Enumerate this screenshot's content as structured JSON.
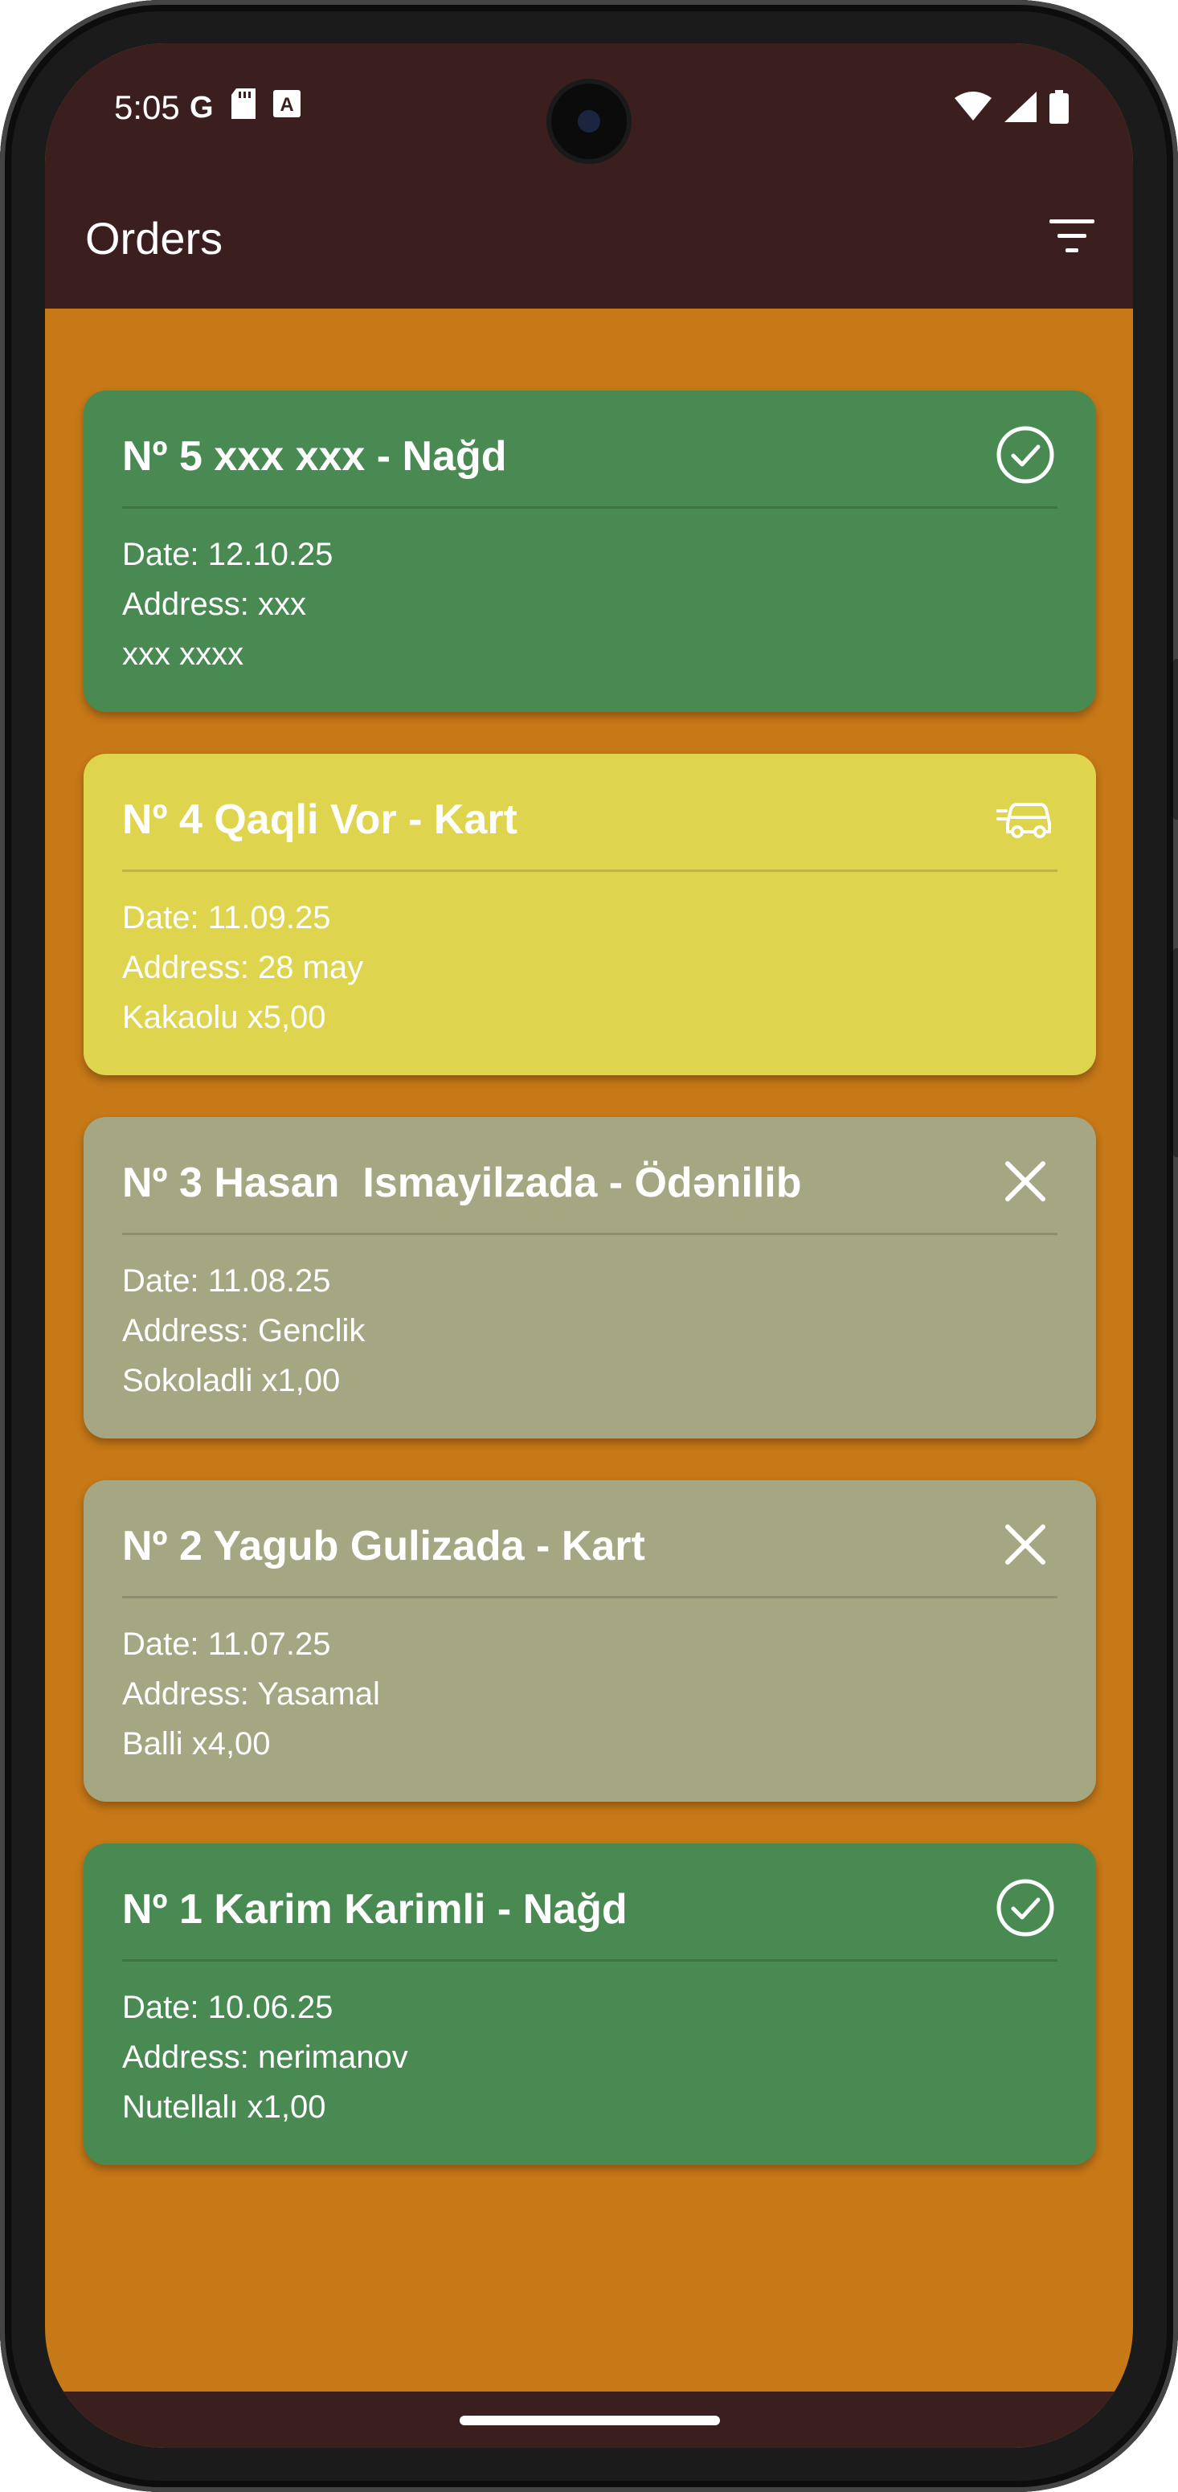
{
  "status_bar": {
    "time": "5:05",
    "left_icons": [
      "google-icon",
      "sd-card-icon",
      "font-icon"
    ],
    "right_icons": [
      "wifi-icon",
      "signal-icon",
      "battery-icon"
    ]
  },
  "app_bar": {
    "title": "Orders",
    "action_icon": "filter-icon"
  },
  "colors": {
    "app_bar": "#3B1F1F",
    "background": "#C77817",
    "completed": "#498A52",
    "in_delivery": "#DED44E",
    "cancelled": "#A5A783"
  },
  "orders": [
    {
      "title": "Nº 5 xxx xxx - Nağd",
      "date": "Date: 12.10.25",
      "address": "Address: xxx",
      "items": "xxx xxxx",
      "status": "completed",
      "status_icon": "check-circle-icon"
    },
    {
      "title": "Nº 4 Qaqli Vor - Kart",
      "date": "Date: 11.09.25",
      "address": "Address: 28 may",
      "items": "Kakaolu x5,00",
      "status": "in_delivery",
      "status_icon": "delivery-car-icon"
    },
    {
      "title": "Nº 3 Hasan  Ismayilzada - Ödənilib",
      "date": "Date: 11.08.25",
      "address": "Address: Genclik",
      "items": "Sokoladli x1,00",
      "status": "cancelled",
      "status_icon": "close-icon"
    },
    {
      "title": "Nº 2 Yagub Gulizada - Kart",
      "date": "Date: 11.07.25",
      "address": "Address: Yasamal",
      "items": "Balli x4,00",
      "status": "cancelled",
      "status_icon": "close-icon"
    },
    {
      "title": "Nº 1 Karim Karimli - Nağd",
      "date": "Date: 10.06.25",
      "address": "Address: nerimanov",
      "items": "Nutellalı x1,00",
      "status": "completed",
      "status_icon": "check-circle-icon"
    }
  ]
}
